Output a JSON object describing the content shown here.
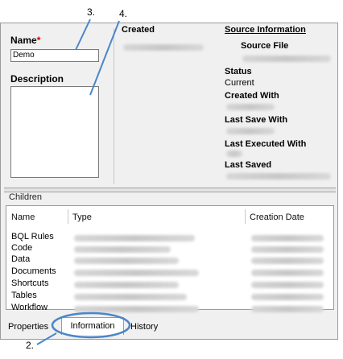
{
  "annotations": {
    "a3": "3.",
    "a4": "4.",
    "a2": "2."
  },
  "form": {
    "name_label": "Name",
    "required_mark": "*",
    "name_value": "Demo",
    "description_label": "Description",
    "created_label": "Created"
  },
  "source": {
    "title": "Source Information",
    "source_file": "Source File",
    "status_label": "Status",
    "status_value": "Current",
    "created_with": "Created With",
    "last_save_with": "Last Save With",
    "last_executed_with": "Last Executed With",
    "last_saved": "Last Saved"
  },
  "children": {
    "title": "Children",
    "columns": [
      "Name",
      "Type",
      "Creation Date"
    ],
    "rows": [
      "BQL Rules",
      "Code",
      "Data",
      "Documents",
      "Shortcuts",
      "Tables",
      "Workflow"
    ]
  },
  "tabs": [
    "Properties",
    "Information",
    "History"
  ],
  "colors": {
    "callout": "#4a86c8",
    "required": "#d00000"
  }
}
